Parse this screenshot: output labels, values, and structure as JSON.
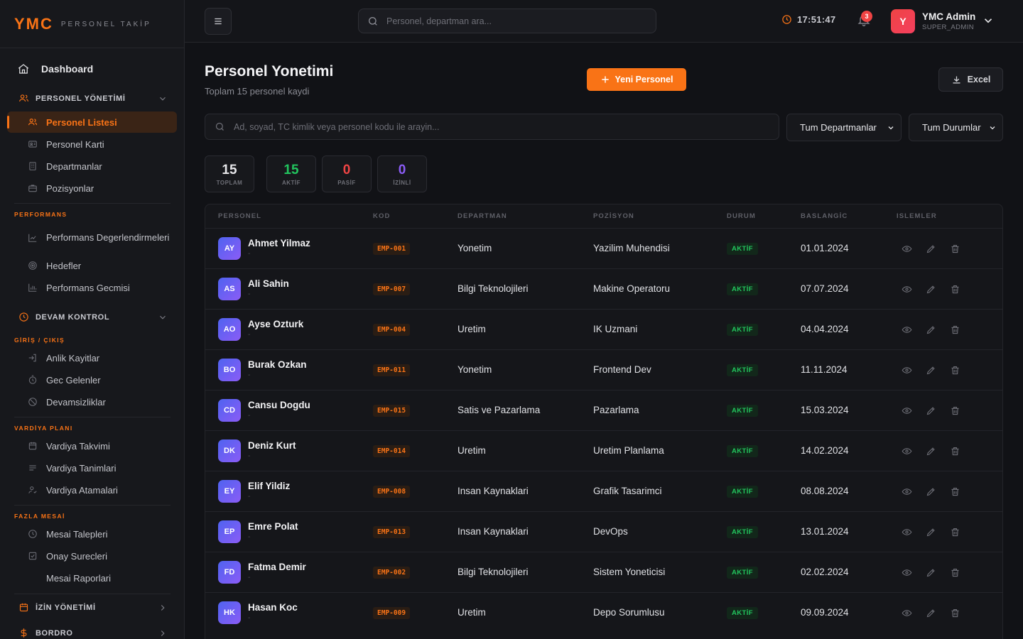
{
  "brand": {
    "logo": "YMC",
    "subtitle": "PERSONEL TAKİP"
  },
  "sidebar": {
    "dashboard": "Dashboard",
    "sections": {
      "personel": "PERSONEL YÖNETİMİ",
      "devam": "DEVAM KONTROL",
      "izin": "İZİN YÖNETİMİ",
      "bordro": "BORDRO"
    },
    "sub_labels": {
      "performans": "PERFORMANS",
      "giris": "GİRİŞ / ÇIKIŞ",
      "vardiya": "VARDİYA PLANI",
      "fazla": "FAZLA MESAİ"
    },
    "items": {
      "personel_listesi": "Personel Listesi",
      "personel_karti": "Personel Karti",
      "departmanlar": "Departmanlar",
      "pozisyonlar": "Pozisyonlar",
      "perf_degerlendirme": "Performans Degerlendirmeleri",
      "hedefler": "Hedefler",
      "perf_gecmisi": "Performans Gecmisi",
      "anlik": "Anlik Kayitlar",
      "gec": "Gec Gelenler",
      "devamsiz": "Devamsizliklar",
      "vardiya_takvimi": "Vardiya Takvimi",
      "vardiya_tanim": "Vardiya Tanimlari",
      "vardiya_atama": "Vardiya Atamalari",
      "mesai_talep": "Mesai Talepleri",
      "onay": "Onay Surecleri",
      "mesai_rapor": "Mesai Raporlari"
    }
  },
  "topbar": {
    "search_placeholder": "Personel, departman ara...",
    "time": "17:51:47",
    "notifications": "3",
    "avatar_letter": "Y",
    "user_name": "YMC Admin",
    "user_role": "SUPER_ADMIN"
  },
  "page": {
    "title": "Personel Yonetimi",
    "subtitle": "Toplam 15 personel kaydi",
    "new_button": "Yeni Personel",
    "excel_button": "Excel",
    "search_placeholder": "Ad, soyad, TC kimlik veya personel kodu ile arayin...",
    "department_filter": "Tum Departmanlar",
    "status_filter": "Tum Durumlar"
  },
  "stats": [
    {
      "value": "15",
      "label": "TOPLAM",
      "color": "#e6e6e9"
    },
    {
      "value": "15",
      "label": "AKTİF",
      "color": "#22c55e"
    },
    {
      "value": "0",
      "label": "PASİF",
      "color": "#ef4444"
    },
    {
      "value": "0",
      "label": "İZİNLİ",
      "color": "#8b5cf6"
    }
  ],
  "table": {
    "headers": [
      "PERSONEL",
      "KOD",
      "DEPARTMAN",
      "POZİSYON",
      "DURUM",
      "BASLANGİC",
      "ISLEMLER"
    ],
    "rows": [
      {
        "initials": "AY",
        "name": "Ahmet Yilmaz",
        "sub": "-",
        "code": "EMP-001",
        "department": "Yonetim",
        "position": "Yazilim Muhendisi",
        "status": "AKTİF",
        "start": "01.01.2024"
      },
      {
        "initials": "AS",
        "name": "Ali Sahin",
        "sub": "-",
        "code": "EMP-007",
        "department": "Bilgi Teknolojileri",
        "position": "Makine Operatoru",
        "status": "AKTİF",
        "start": "07.07.2024"
      },
      {
        "initials": "AO",
        "name": "Ayse Ozturk",
        "sub": "-",
        "code": "EMP-004",
        "department": "Uretim",
        "position": "IK Uzmani",
        "status": "AKTİF",
        "start": "04.04.2024"
      },
      {
        "initials": "BO",
        "name": "Burak Ozkan",
        "sub": "-",
        "code": "EMP-011",
        "department": "Yonetim",
        "position": "Frontend Dev",
        "status": "AKTİF",
        "start": "11.11.2024"
      },
      {
        "initials": "CD",
        "name": "Cansu Dogdu",
        "sub": "-",
        "code": "EMP-015",
        "department": "Satis ve Pazarlama",
        "position": "Pazarlama",
        "status": "AKTİF",
        "start": "15.03.2024"
      },
      {
        "initials": "DK",
        "name": "Deniz Kurt",
        "sub": "-",
        "code": "EMP-014",
        "department": "Uretim",
        "position": "Uretim Planlama",
        "status": "AKTİF",
        "start": "14.02.2024"
      },
      {
        "initials": "EY",
        "name": "Elif Yildiz",
        "sub": "-",
        "code": "EMP-008",
        "department": "Insan Kaynaklari",
        "position": "Grafik Tasarimci",
        "status": "AKTİF",
        "start": "08.08.2024"
      },
      {
        "initials": "EP",
        "name": "Emre Polat",
        "sub": "-",
        "code": "EMP-013",
        "department": "Insan Kaynaklari",
        "position": "DevOps",
        "status": "AKTİF",
        "start": "13.01.2024"
      },
      {
        "initials": "FD",
        "name": "Fatma Demir",
        "sub": "-",
        "code": "EMP-002",
        "department": "Bilgi Teknolojileri",
        "position": "Sistem Yoneticisi",
        "status": "AKTİF",
        "start": "02.02.2024"
      },
      {
        "initials": "HK",
        "name": "Hasan Koc",
        "sub": "-",
        "code": "EMP-009",
        "department": "Uretim",
        "position": "Depo Sorumlusu",
        "status": "AKTİF",
        "start": "09.09.2024"
      }
    ]
  },
  "colors": {
    "accent": "#f97316",
    "success": "#22c55e",
    "danger": "#ef4444",
    "violet": "#8b5cf6"
  }
}
